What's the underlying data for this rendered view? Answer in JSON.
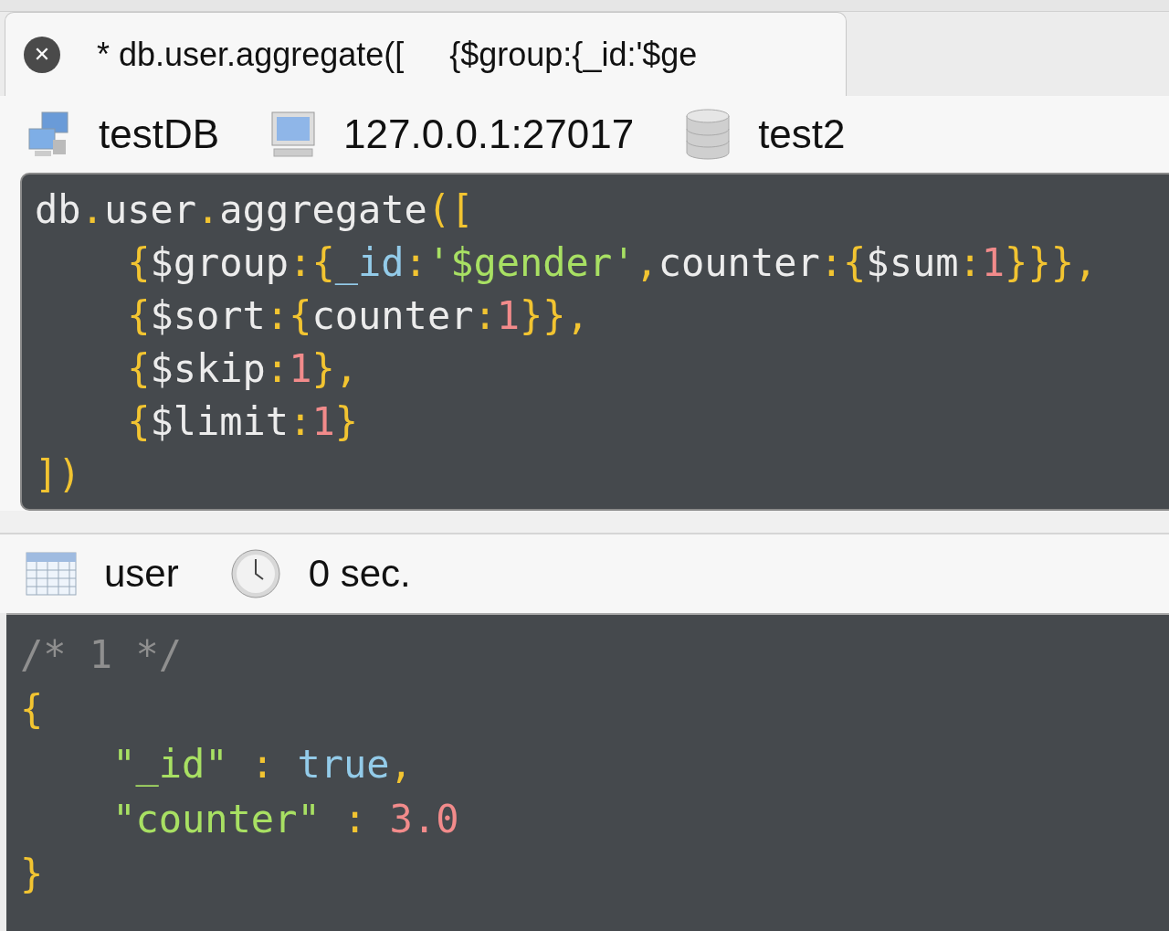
{
  "tab": {
    "close_symbol": "✕",
    "title": "* db.user.aggregate([     {$group:{_id:'$ge",
    "selected": true
  },
  "connection_bar": [
    {
      "kind": "network",
      "label": "testDB"
    },
    {
      "kind": "computer",
      "label": "127.0.0.1:27017"
    },
    {
      "kind": "database",
      "label": "test2"
    }
  ],
  "query_editor": {
    "lines": [
      [
        {
          "text": "db",
          "kind": "plain"
        },
        {
          "text": ".",
          "kind": "punct"
        },
        {
          "text": "user",
          "kind": "plain"
        },
        {
          "text": ".",
          "kind": "punct"
        },
        {
          "text": "aggregate",
          "kind": "plain"
        },
        {
          "text": "([",
          "kind": "punct"
        }
      ],
      [
        {
          "text": "    {",
          "kind": "punct"
        },
        {
          "text": "$group",
          "kind": "plain"
        },
        {
          "text": ":{",
          "kind": "punct"
        },
        {
          "text": "_id",
          "kind": "key"
        },
        {
          "text": ":",
          "kind": "punct"
        },
        {
          "text": "'$gender'",
          "kind": "string"
        },
        {
          "text": ",",
          "kind": "punct"
        },
        {
          "text": "counter",
          "kind": "plain"
        },
        {
          "text": ":{",
          "kind": "punct"
        },
        {
          "text": "$sum",
          "kind": "plain"
        },
        {
          "text": ":",
          "kind": "punct"
        },
        {
          "text": "1",
          "kind": "number"
        },
        {
          "text": "}}},",
          "kind": "punct"
        }
      ],
      [
        {
          "text": "    {",
          "kind": "punct"
        },
        {
          "text": "$sort",
          "kind": "plain"
        },
        {
          "text": ":{",
          "kind": "punct"
        },
        {
          "text": "counter",
          "kind": "plain"
        },
        {
          "text": ":",
          "kind": "punct"
        },
        {
          "text": "1",
          "kind": "number"
        },
        {
          "text": "}},",
          "kind": "punct"
        }
      ],
      [
        {
          "text": "    {",
          "kind": "punct"
        },
        {
          "text": "$skip",
          "kind": "plain"
        },
        {
          "text": ":",
          "kind": "punct"
        },
        {
          "text": "1",
          "kind": "number"
        },
        {
          "text": "},",
          "kind": "punct"
        }
      ],
      [
        {
          "text": "    {",
          "kind": "punct"
        },
        {
          "text": "$limit",
          "kind": "plain"
        },
        {
          "text": ":",
          "kind": "punct"
        },
        {
          "text": "1",
          "kind": "number"
        },
        {
          "text": "}",
          "kind": "punct"
        }
      ],
      [
        {
          "text": "])",
          "kind": "punct"
        }
      ]
    ]
  },
  "result_bar": [
    {
      "kind": "table",
      "label": "user"
    },
    {
      "kind": "clock",
      "label": "0 sec."
    }
  ],
  "result": {
    "lines": [
      [
        {
          "text": "/* 1 */",
          "kind": "comment"
        }
      ],
      [
        {
          "text": "{",
          "kind": "punct"
        }
      ],
      [
        {
          "text": "    \"_id\"",
          "kind": "string"
        },
        {
          "text": " : ",
          "kind": "punct"
        },
        {
          "text": "true",
          "kind": "key"
        },
        {
          "text": ",",
          "kind": "punct"
        }
      ],
      [
        {
          "text": "    \"counter\"",
          "kind": "string"
        },
        {
          "text": " : ",
          "kind": "punct"
        },
        {
          "text": "3.0",
          "kind": "number"
        }
      ],
      [
        {
          "text": "}",
          "kind": "punct"
        }
      ]
    ]
  }
}
